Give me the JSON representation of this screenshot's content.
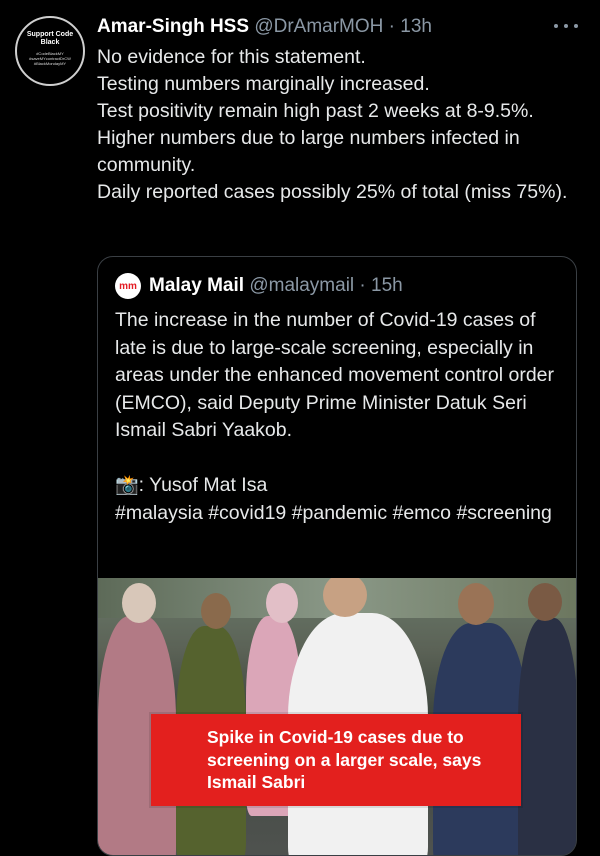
{
  "tweet": {
    "author_name": "Amar-Singh HSS",
    "handle": "@DrAmarMOH",
    "separator": "·",
    "time": "13h",
    "lines": [
      "No evidence for this statement.",
      "Testing numbers marginally increased.",
      "Test positivity remain high past 2 weeks at 8-9.5%.",
      "Higher numbers due to large numbers infected in community.",
      "Daily reported cases possibly 25% of total (miss 75%)."
    ]
  },
  "avatar": {
    "title": "Support Code Black",
    "small_lines": [
      "#CodeBlackMY",
      "#saveMYcontractDrCW",
      "#BlackMondayMY"
    ]
  },
  "quote": {
    "logo_text": "mm",
    "author_name": "Malay Mail",
    "handle": "@malaymail",
    "separator": "·",
    "time": "15h",
    "body": "The increase in the number of Covid-19 cases of late is due to large-scale screening, especially in areas under the enhanced movement control order (EMCO), said Deputy Prime Minister Datuk Seri Ismail Sabri Yaakob.",
    "camera_emoji": "📸",
    "credit": ": Yusof Mat Isa",
    "hashtags": "#malaysia #covid19 #pandemic #emco #screening",
    "image_caption": "Spike in Covid-19 cases due to screening on a larger scale, says Ismail Sabri"
  },
  "colors": {
    "background": "#000000",
    "text": "#e7e9ea",
    "dim": "#8b98a5",
    "banner_red": "#e3201e"
  }
}
